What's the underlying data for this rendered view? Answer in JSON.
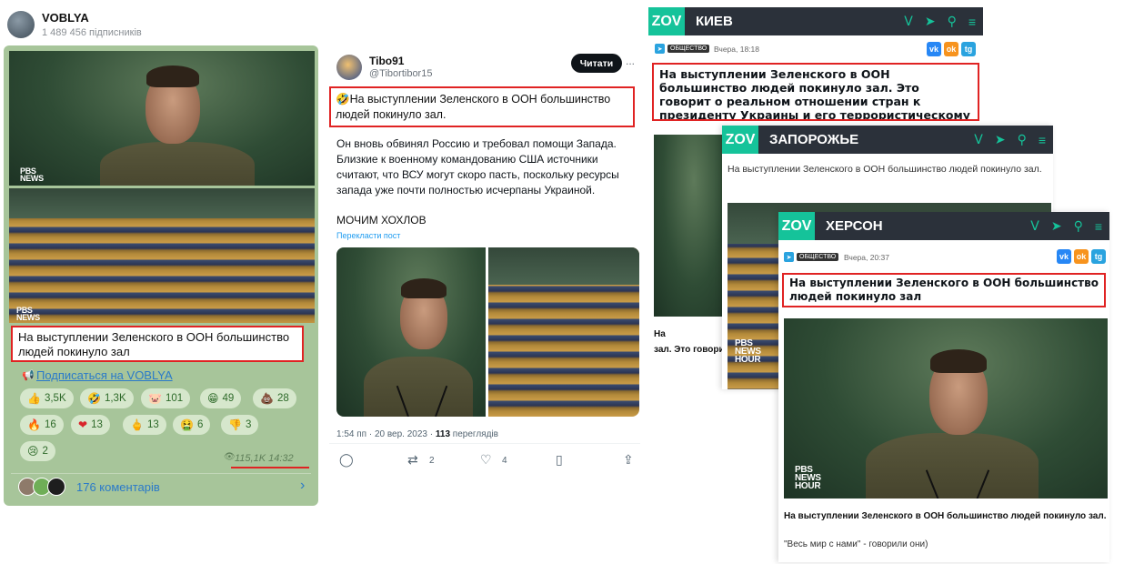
{
  "telegram": {
    "channel_name": "VOBLYA",
    "subscribers": "1 489 456 підписників",
    "caption": "На выступлении Зеленского в ООН большинство людей покинуло зал",
    "subscribe_link": "Подписаться на VOBLYA",
    "reactions": [
      {
        "emoji": "👍",
        "count": "3,5K"
      },
      {
        "emoji": "🤣",
        "count": "1,3K"
      },
      {
        "emoji": "🐷",
        "count": "101"
      },
      {
        "emoji": "😁",
        "count": "49"
      },
      {
        "emoji": "💩",
        "count": "28"
      },
      {
        "emoji": "🔥",
        "count": "16"
      },
      {
        "emoji": "❤",
        "count": "13"
      },
      {
        "emoji": "🖕",
        "count": "13"
      },
      {
        "emoji": "🤮",
        "count": "6"
      },
      {
        "emoji": "👎",
        "count": "3"
      },
      {
        "emoji": "😢",
        "count": "2"
      }
    ],
    "views_time": "115,1K 14:32",
    "comments": "176 коментарів",
    "watermark": [
      "PBS",
      "NEWS"
    ]
  },
  "twitter": {
    "display_name": "Tibo91",
    "handle": "@Tibortibor15",
    "follow_label": "Читати",
    "more": "...",
    "boxed_text": "🤣На выступлении Зеленского в ООН большинство людей покинуло зал.",
    "body": "Он вновь обвинял Россию и требовал помощи Запада. Близкие к военному командованию США источники считают, что ВСУ могут скоро пасть, поскольку ресурсы запада уже почти полностью исчерпаны Украиной.",
    "shout": "МОЧИМ ХОХЛОВ",
    "translate": "Перекласти пост",
    "meta_time": "1:54 пп · 20 вер. 2023 · ",
    "meta_views_num": "113",
    "meta_views_label": " переглядів",
    "actions": {
      "reply_icon": "reply-icon",
      "retweet_icon": "retweet-icon",
      "retweets": "2",
      "like_icon": "heart-icon",
      "likes": "4",
      "bookmark_icon": "bookmark-icon",
      "share_icon": "share-icon"
    }
  },
  "zov_kiev": {
    "logo": "ZOV",
    "city": "КИЕВ",
    "tag": "ОБЩЕСТВО",
    "time": "Вчера, 18:18",
    "headline": "На выступлении Зеленского в ООН большинство людей покинуло зал. Это говорит о реальном отношении стран к президенту Украины и его террористическому режиму",
    "excerpt_line1": "На",
    "excerpt_line2": "зал. Это говори"
  },
  "zov_zaporozhye": {
    "logo": "ZOV",
    "city": "ЗАПОРОЖЬЕ",
    "headline": "На выступлении Зеленского в ООН большинство людей покинуло зал."
  },
  "zov_kherson": {
    "logo": "ZOV",
    "city": "ХЕРСОН",
    "tag": "ОБЩЕСТВО",
    "time": "Вчера, 20:37",
    "headline": "На выступлении Зеленского в ООН большинство людей покинуло зал",
    "caption": "На выступлении Зеленского в ООН большинство людей покинуло зал.",
    "quote": "\"Весь мир с нами\" - говорили они)",
    "watermark": [
      "PBS",
      "NEWS",
      "HOUR"
    ]
  },
  "social": {
    "vk": "vk",
    "ok": "ok",
    "tg": "tg"
  },
  "colors": {
    "highlight": "#e02323",
    "zov_green": "#15c39a",
    "zov_bar": "#2b313a",
    "telegram_bg": "#a7c59a",
    "link": "#2a7ac9"
  }
}
